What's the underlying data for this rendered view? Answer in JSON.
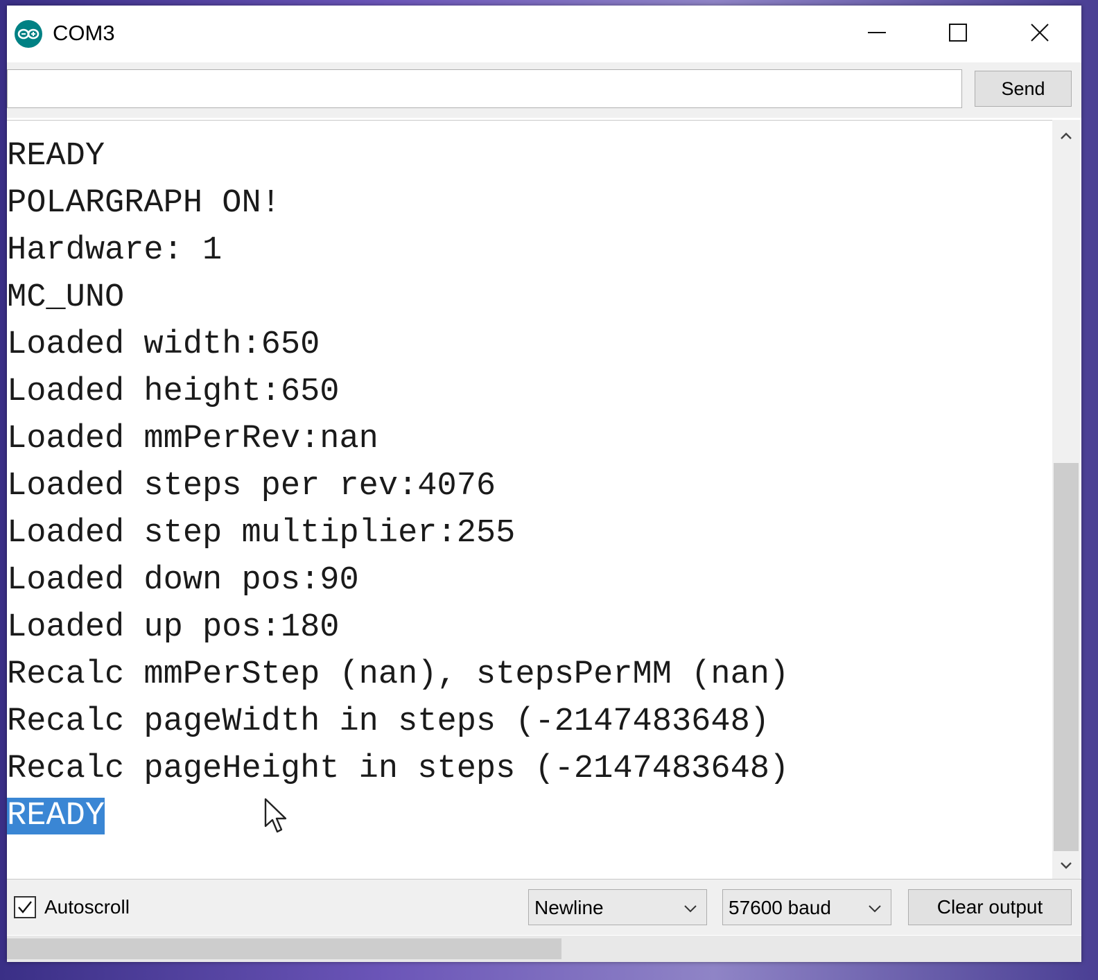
{
  "window": {
    "title": "COM3",
    "icon": "arduino-infinity-icon",
    "accent_color": "#008184"
  },
  "send_bar": {
    "input_value": "",
    "send_label": "Send"
  },
  "output": {
    "partial_top_line": "  - - - - - - - - - - - - - - -",
    "lines": [
      "READY",
      "POLARGRAPH ON!",
      "Hardware: 1",
      "MC_UNO",
      "Loaded width:650",
      "Loaded height:650",
      "Loaded mmPerRev:nan",
      "Loaded steps per rev:4076",
      "Loaded step multiplier:255",
      "Loaded down pos:90",
      "Loaded up pos:180",
      "Recalc mmPerStep (nan), stepsPerMM (nan)",
      "Recalc pageWidth in steps (-2147483648)",
      "Recalc pageHeight in steps (-2147483648)",
      "READY"
    ],
    "selection_color": "#3a86d4"
  },
  "bottom_bar": {
    "autoscroll_label": "Autoscroll",
    "autoscroll_checked": true,
    "line_ending": "Newline",
    "baud_rate": "57600 baud",
    "clear_label": "Clear output"
  }
}
